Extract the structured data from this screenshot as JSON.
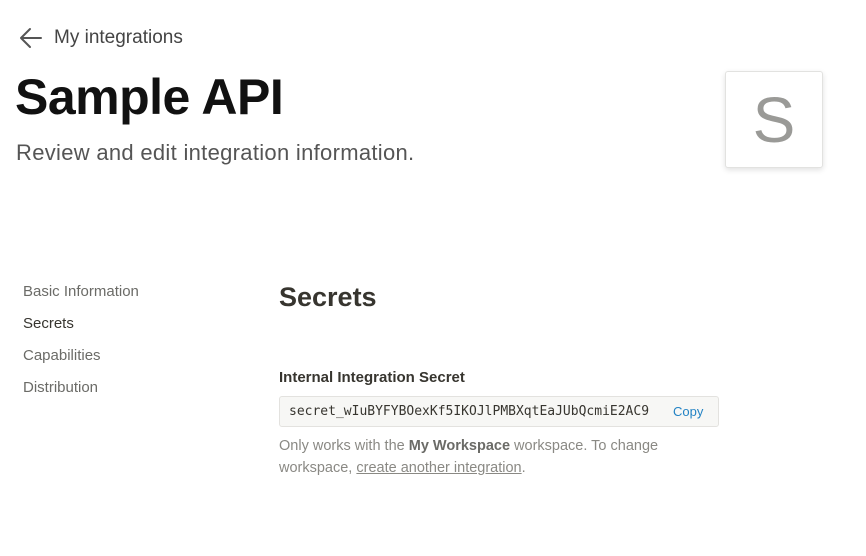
{
  "header": {
    "back_label": "My integrations",
    "title": "Sample API",
    "subtitle": "Review and edit integration information.",
    "avatar_letter": "S"
  },
  "sidebar": {
    "items": [
      {
        "label": "Basic Information",
        "active": false
      },
      {
        "label": "Secrets",
        "active": true
      },
      {
        "label": "Capabilities",
        "active": false
      },
      {
        "label": "Distribution",
        "active": false
      }
    ]
  },
  "main": {
    "section_title": "Secrets",
    "secret_label": "Internal Integration Secret",
    "secret_value": "secret_wIuBYFYBOexKf5IKOJlPMBXqtEaJUbQcmiE2AC9",
    "copy_label": "Copy",
    "help_prefix": "Only works with the ",
    "help_workspace": "My Workspace",
    "help_middle": " workspace. To change workspace, ",
    "help_link": "create another integration",
    "help_suffix": "."
  }
}
